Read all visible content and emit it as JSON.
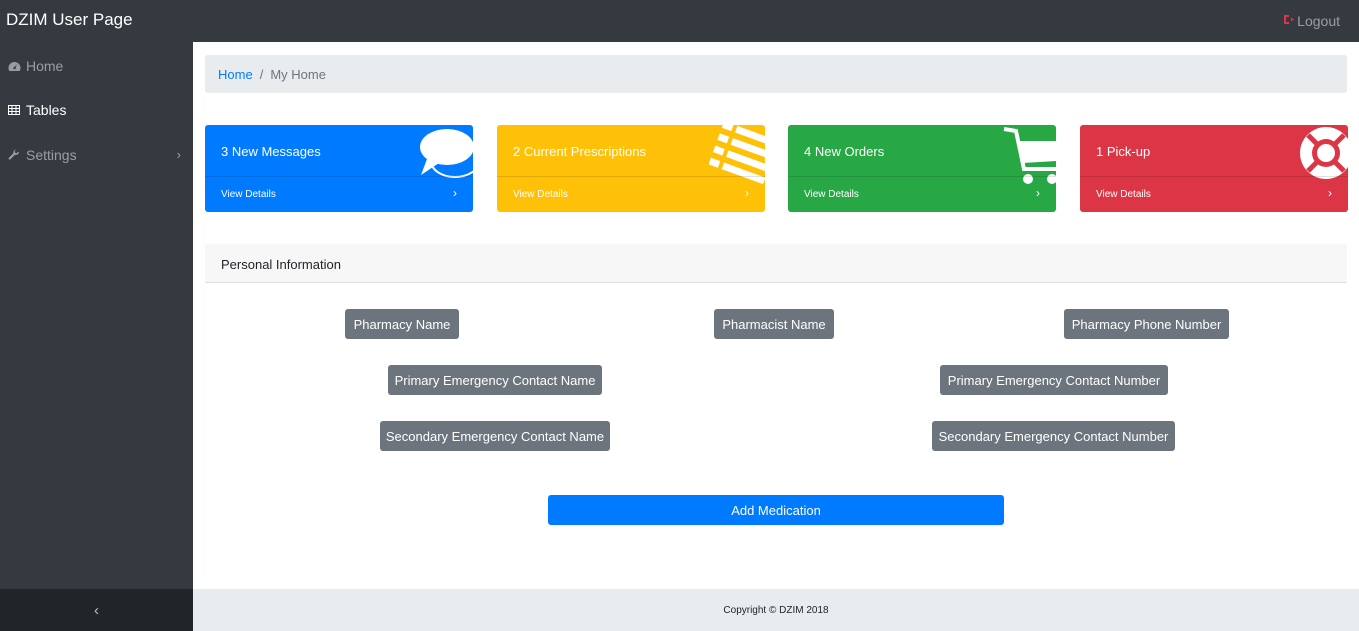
{
  "app": {
    "title": "DZIM User Page",
    "logout_label": "Logout"
  },
  "sidebar": {
    "items": [
      {
        "label": "Home",
        "icon": "dashboard-icon"
      },
      {
        "label": "Tables",
        "icon": "table-icon"
      },
      {
        "label": "Settings",
        "icon": "wrench-icon",
        "chevron": "›"
      }
    ],
    "collapse_icon": "‹"
  },
  "breadcrumb": {
    "home": "Home",
    "separator": "/",
    "current": "My Home"
  },
  "cards": [
    {
      "title": "3 New Messages",
      "details": "View Details",
      "arrow": "›",
      "color": "#007bff",
      "icon": "comments-icon"
    },
    {
      "title": "2 Current Prescriptions",
      "details": "View Details",
      "arrow": "›",
      "color": "#ffc107",
      "icon": "list-icon"
    },
    {
      "title": "4 New Orders",
      "details": "View Details",
      "arrow": "›",
      "color": "#28a745",
      "icon": "shopping-cart-icon"
    },
    {
      "title": "1 Pick-up",
      "details": "View Details",
      "arrow": "›",
      "color": "#dc3545",
      "icon": "life-ring-icon"
    }
  ],
  "personal_info": {
    "header": "Personal Information",
    "fields": {
      "pharmacy_name": "Pharmacy Name",
      "pharmacist_name": "Pharmacist Name",
      "pharmacy_phone": "Pharmacy Phone Number",
      "primary_contact_name": "Primary Emergency Contact Name",
      "primary_contact_number": "Primary Emergency Contact Number",
      "secondary_contact_name": "Secondary Emergency Contact Name",
      "secondary_contact_number": "Secondary Emergency Contact Number"
    },
    "add_button": "Add Medication"
  },
  "footer": {
    "copyright": "Copyright © DZIM 2018"
  }
}
